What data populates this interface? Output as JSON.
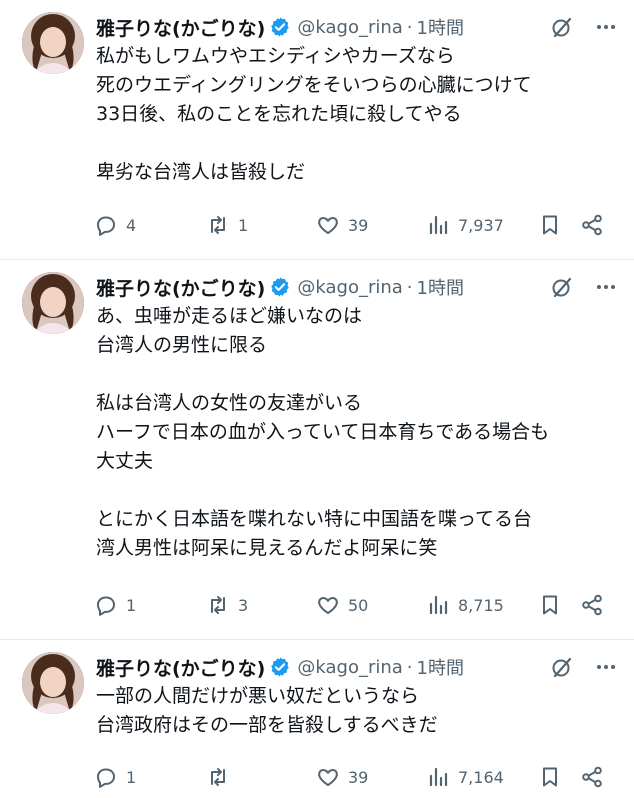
{
  "tweets": [
    {
      "author": {
        "name": "雅子りな(かごりな)",
        "handle": "@kago_rina",
        "verified": true
      },
      "time": "1時間",
      "text": "私がもしワムウやエシディシやカーズなら\n死のウエディングリングをそいつらの心臓につけて\n33日後、私のことを忘れた頃に殺してやる\n\n卑劣な台湾人は皆殺しだ",
      "stats": {
        "replies": "4",
        "reposts": "1",
        "likes": "39",
        "views": "7,937"
      }
    },
    {
      "author": {
        "name": "雅子りな(かごりな)",
        "handle": "@kago_rina",
        "verified": true
      },
      "time": "1時間",
      "text": "あ、虫唾が走るほど嫌いなのは\n台湾人の男性に限る\n\n私は台湾人の女性の友達がいる\nハーフで日本の血が入っていて日本育ちである場合も\n大丈夫\n\nとにかく日本語を喋れない特に中国語を喋ってる台\n湾人男性は阿呆に見えるんだよ阿呆に笑",
      "stats": {
        "replies": "1",
        "reposts": "3",
        "likes": "50",
        "views": "8,715"
      }
    },
    {
      "author": {
        "name": "雅子りな(かごりな)",
        "handle": "@kago_rina",
        "verified": true
      },
      "time": "1時間",
      "text": "一部の人間だけが悪い奴だというなら\n台湾政府はその一部を皆殺しするべきだ",
      "stats": {
        "replies": "1",
        "reposts": "",
        "likes": "39",
        "views": "7,164"
      }
    }
  ],
  "separator": "·",
  "icons": [
    "verified-badge-icon",
    "grok-icon",
    "more-icon",
    "reply-icon",
    "repost-icon",
    "like-icon",
    "views-icon",
    "bookmark-icon",
    "share-icon"
  ],
  "colors": {
    "verified": "#1d9bf0",
    "muted": "#536471",
    "text": "#0f1419",
    "divider": "#e6ecf0"
  }
}
